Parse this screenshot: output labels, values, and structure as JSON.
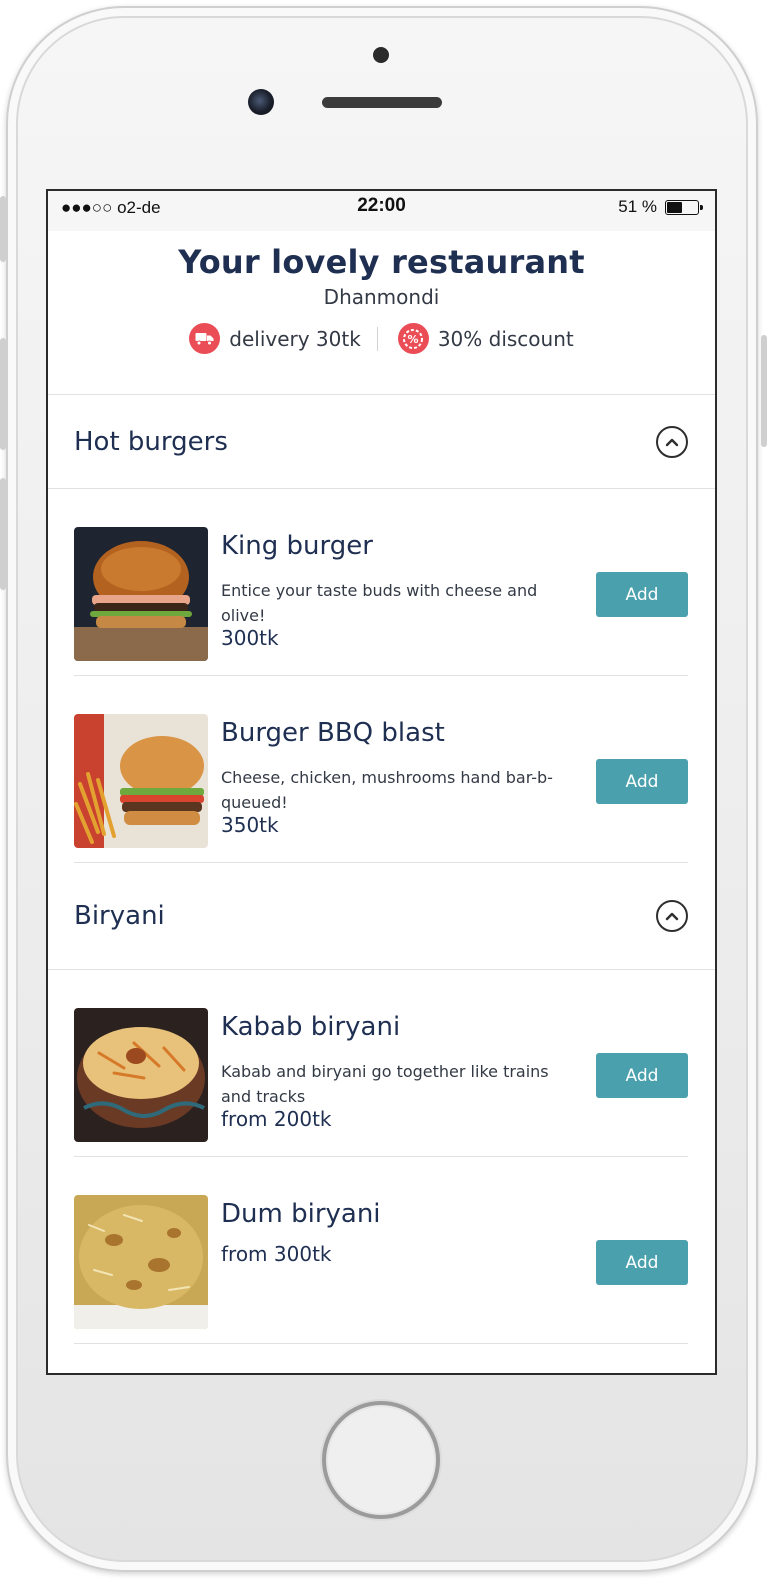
{
  "status_bar": {
    "carrier": "●●●○○ o2-de",
    "time": "22:00",
    "battery_text": "51 %",
    "battery_level": 0.51
  },
  "restaurant": {
    "title": "Your lovely restaurant",
    "area": "Dhanmondi",
    "delivery": "delivery 30tk",
    "discount": "30% discount",
    "accent_color": "#ea4d55"
  },
  "colors": {
    "heading": "#1f2f52",
    "add_button": "#4aa1ad"
  },
  "categories": [
    {
      "name": "Hot burgers",
      "items": [
        {
          "name": "King burger",
          "description": "Entice your taste buds with cheese and olive!",
          "price": "300tk",
          "button": "Add"
        },
        {
          "name": "Burger BBQ blast",
          "description": "Cheese, chicken, mushrooms hand bar-b-queued!",
          "price": "350tk",
          "button": "Add"
        }
      ]
    },
    {
      "name": "Biryani",
      "items": [
        {
          "name": "Kabab biryani",
          "description": "Kabab and biryani go together like trains and tracks",
          "price": "from 200tk",
          "button": "Add"
        },
        {
          "name": "Dum biryani",
          "description": "",
          "price": "from 300tk",
          "button": "Add"
        }
      ]
    }
  ]
}
